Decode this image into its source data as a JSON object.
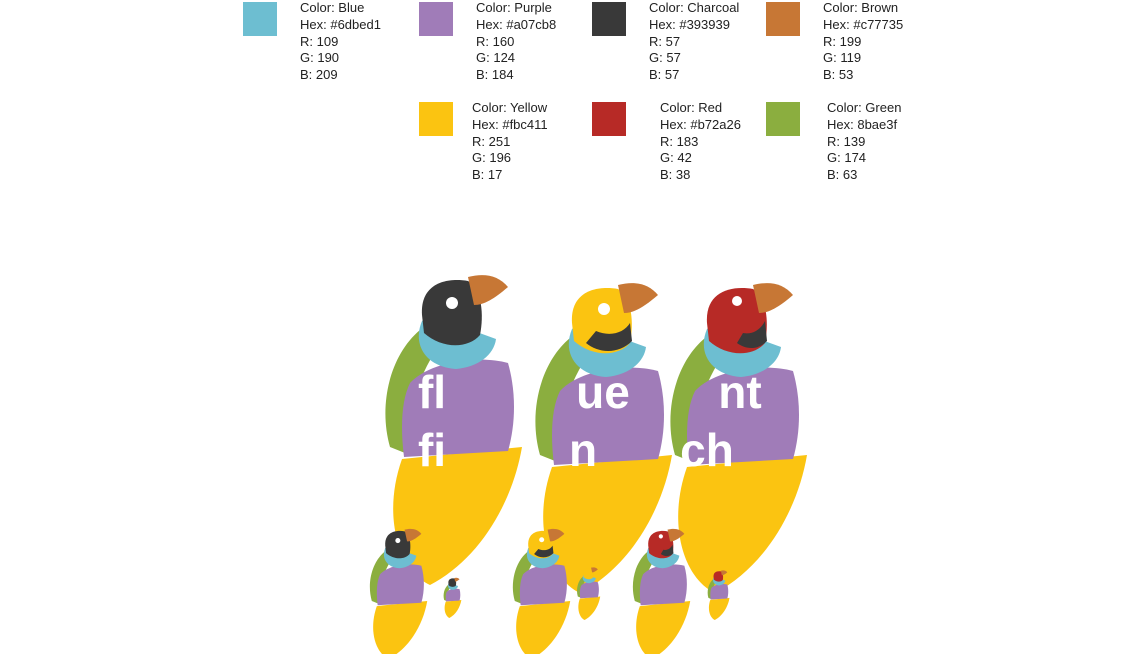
{
  "palette": [
    {
      "name": "Color: Blue",
      "hex": "Hex: #6dbed1",
      "r": "R: 109",
      "g": "G: 190",
      "b": "B: 209",
      "swatch": "#6dbed1"
    },
    {
      "name": "Color: Purple",
      "hex": "Hex: #a07cb8",
      "r": "R: 160",
      "g": "G: 124",
      "b": "B: 184",
      "swatch": "#a07cb8"
    },
    {
      "name": "Color: Charcoal",
      "hex": "Hex: #393939",
      "r": "R: 57",
      "g": "G: 57",
      "b": "B: 57",
      "swatch": "#393939"
    },
    {
      "name": "Color: Brown",
      "hex": "Hex: #c77735",
      "r": "R: 199",
      "g": "G: 119",
      "b": "B: 53",
      "swatch": "#c77735"
    },
    {
      "name": "Color: Yellow",
      "hex": "Hex: #fbc411",
      "r": "R: 251",
      "g": "G: 196",
      "b": "B: 17",
      "swatch": "#fbc411"
    },
    {
      "name": "Color: Red",
      "hex": "Hex: #b72a26",
      "r": "R: 183",
      "g": "G: 42",
      "b": "B: 38",
      "swatch": "#b72a26"
    },
    {
      "name": "Color: Green",
      "hex": "Hex: 8bae3f",
      "r": "R: 139",
      "g": "G: 174",
      "b": "B: 63",
      "swatch": "#8bae3f"
    }
  ],
  "logo": {
    "birds": [
      {
        "head": "charcoal",
        "top_text": "fl",
        "bottom_text": "fi"
      },
      {
        "head": "yellow",
        "top_text": "ue",
        "bottom_text": "n"
      },
      {
        "head": "red",
        "top_text": "nt",
        "bottom_text": "ch"
      }
    ]
  }
}
